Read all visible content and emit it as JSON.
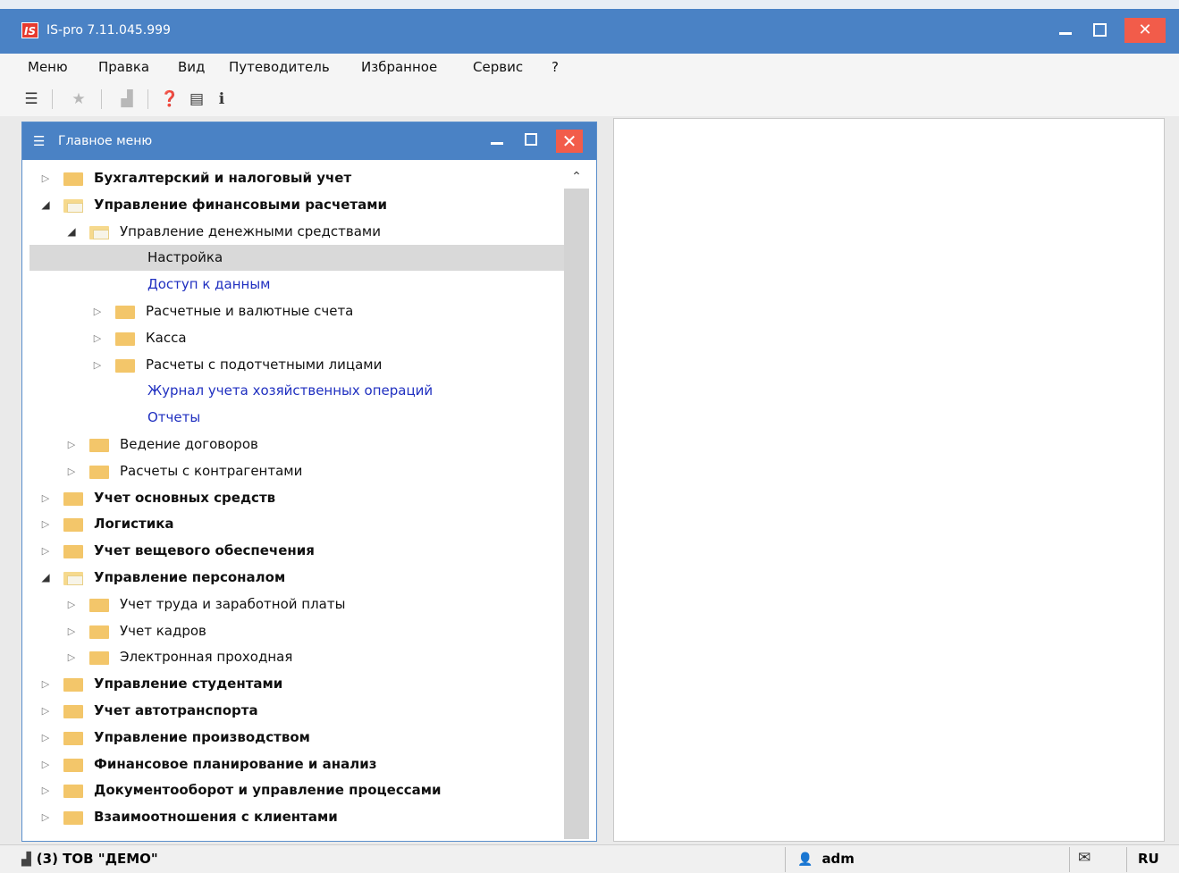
{
  "app": {
    "logo": "IS",
    "title": "IS-pro 7.11.045.999"
  },
  "menu": [
    "Меню",
    "Правка",
    "Вид",
    "Путеводитель",
    "Избранное",
    "Сервис",
    "?"
  ],
  "toolbar": {
    "icons": [
      "main-menu-icon",
      "favorites-star-icon",
      "chart-icon",
      "help-icon",
      "doc-info-icon",
      "info-icon"
    ]
  },
  "main_menu_window": {
    "title": "Главное меню"
  },
  "tree": [
    {
      "label": "Бухгалтерский и налоговый учет",
      "level": 0,
      "state": "collapsed",
      "bold": true,
      "folder": true
    },
    {
      "label": "Управление финансовыми расчетами",
      "level": 0,
      "state": "expanded",
      "bold": true,
      "folder": true
    },
    {
      "label": "Управление денежными средствами",
      "level": 1,
      "state": "expanded",
      "bold": false,
      "folder": true
    },
    {
      "label": "Настройка",
      "level": 2,
      "state": "leaf",
      "selected": true
    },
    {
      "label": "Доступ к данным",
      "level": 2,
      "state": "leaf",
      "link": true
    },
    {
      "label": "Расчетные и валютные счета",
      "level": 2,
      "state": "collapsed",
      "folder": true
    },
    {
      "label": "Касса",
      "level": 2,
      "state": "collapsed",
      "folder": true
    },
    {
      "label": "Расчеты с подотчетными лицами",
      "level": 2,
      "state": "collapsed",
      "folder": true
    },
    {
      "label": "Журнал учета хозяйственных операций",
      "level": 2,
      "state": "leaf",
      "link": true
    },
    {
      "label": "Отчеты",
      "level": 2,
      "state": "leaf",
      "link": true
    },
    {
      "label": "Ведение договоров",
      "level": 1,
      "state": "collapsed",
      "folder": true
    },
    {
      "label": "Расчеты с контрагентами",
      "level": 1,
      "state": "collapsed",
      "folder": true
    },
    {
      "label": "Учет основных средств",
      "level": 0,
      "state": "collapsed",
      "bold": true,
      "folder": true
    },
    {
      "label": "Логистика",
      "level": 0,
      "state": "collapsed",
      "bold": true,
      "folder": true
    },
    {
      "label": "Учет вещевого обеспечения",
      "level": 0,
      "state": "collapsed",
      "bold": true,
      "folder": true
    },
    {
      "label": "Управление персоналом",
      "level": 0,
      "state": "expanded",
      "bold": true,
      "folder": true
    },
    {
      "label": "Учет труда и заработной платы",
      "level": 1,
      "state": "collapsed",
      "folder": true
    },
    {
      "label": "Учет кадров",
      "level": 1,
      "state": "collapsed",
      "folder": true
    },
    {
      "label": "Электронная проходная",
      "level": 1,
      "state": "collapsed",
      "folder": true
    },
    {
      "label": "Управление студентами",
      "level": 0,
      "state": "collapsed",
      "bold": true,
      "folder": true
    },
    {
      "label": "Учет автотранспорта",
      "level": 0,
      "state": "collapsed",
      "bold": true,
      "folder": true
    },
    {
      "label": "Управление производством",
      "level": 0,
      "state": "collapsed",
      "bold": true,
      "folder": true
    },
    {
      "label": "Финансовое планирование и анализ",
      "level": 0,
      "state": "collapsed",
      "bold": true,
      "folder": true
    },
    {
      "label": "Документооборот и управление процессами",
      "level": 0,
      "state": "collapsed",
      "bold": true,
      "folder": true
    },
    {
      "label": "Взаимоотношения с клиентами",
      "level": 0,
      "state": "collapsed",
      "bold": true,
      "folder": true
    }
  ],
  "status": {
    "org": "(3) ТОВ \"ДЕМО\"",
    "user": "adm",
    "lang": "RU"
  },
  "colors": {
    "titlebar": "#4a82c5",
    "close": "#f25c4a",
    "folder": "#f3c66a",
    "link": "#1f2fc0",
    "selected_row": "#d9d9d9"
  }
}
